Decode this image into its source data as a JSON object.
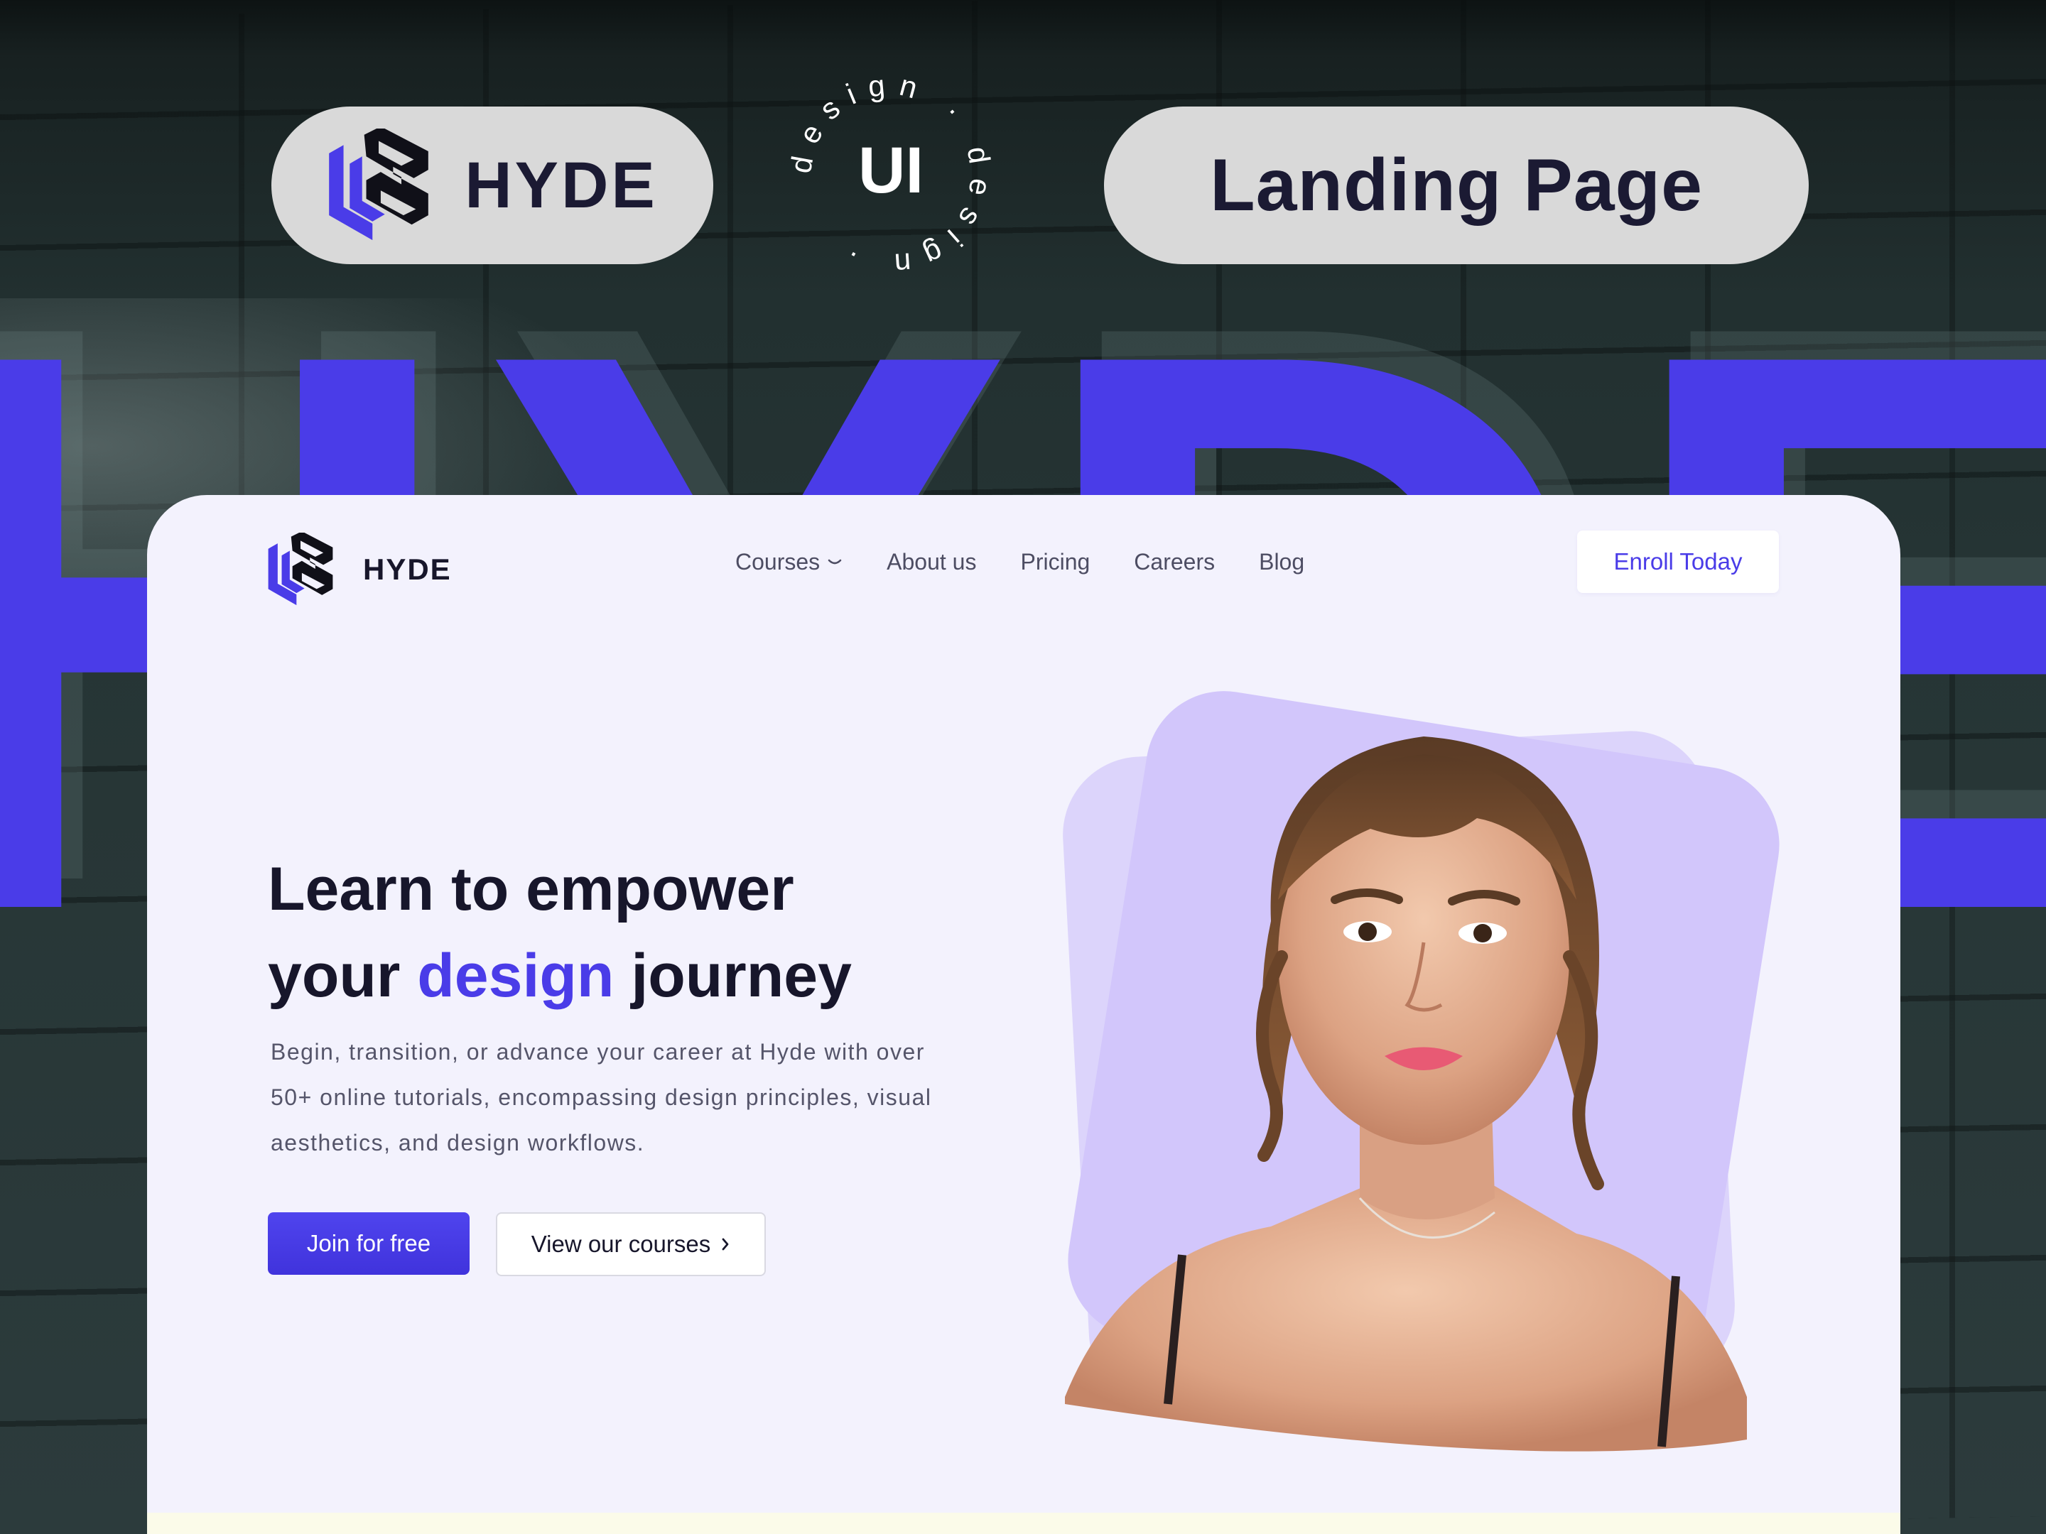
{
  "poster": {
    "brand_name": "HYDE",
    "badge_ring_text": "design · design · ",
    "badge_center": "UI",
    "title_pill": "Landing Page",
    "background_word": "HYDE"
  },
  "navbar": {
    "brand_name": "HYDE",
    "links": [
      {
        "label": "Courses",
        "has_dropdown": true
      },
      {
        "label": "About us"
      },
      {
        "label": "Pricing"
      },
      {
        "label": "Careers"
      },
      {
        "label": "Blog"
      }
    ],
    "cta_label": "Enroll Today"
  },
  "hero": {
    "title_line1": "Learn to empower",
    "title_line2_prefix": "your ",
    "title_line2_accent": "design",
    "title_line2_suffix": " journey",
    "description": "Begin, transition, or advance your career at Hyde with over 50+ online tutorials, encompassing design principles, visual aesthetics, and design workflows.",
    "primary_button": "Join for free",
    "secondary_button": "View our courses"
  },
  "icons": {
    "logo": "hyde-logo-icon",
    "dropdown": "chevron-down-icon",
    "arrow": "chevron-right-icon"
  },
  "colors": {
    "accent": "#4a3ce8",
    "card_background": "#f3f2fd",
    "pill_background": "#d9d9d9",
    "heading_text": "#17162b",
    "portrait_backdrop": "#d2c6fb"
  }
}
